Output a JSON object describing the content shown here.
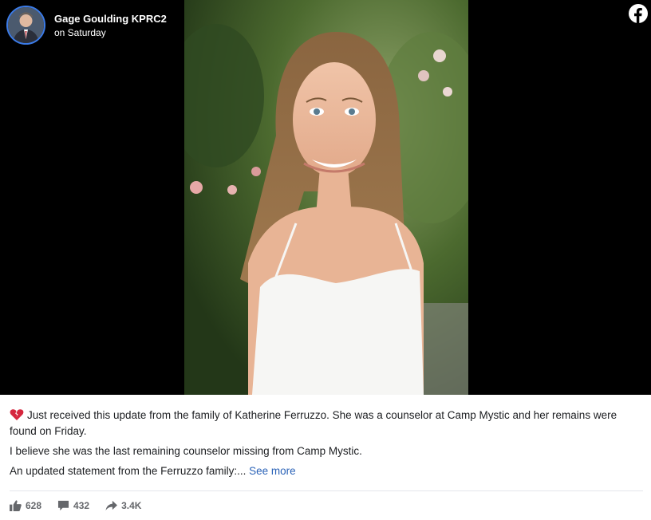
{
  "post": {
    "author": "Gage Goulding KPRC2",
    "time": "on Saturday",
    "avatar_icon": "person-avatar",
    "platform_icon": "facebook-icon",
    "accent_color": "#3b7be8",
    "link_color": "#2a62b7"
  },
  "caption": {
    "emoji_icon": "broken-heart-icon",
    "line1": "Just received this update from the family of Katherine Ferruzzo. She was a counselor at Camp Mystic and her remains were found on Friday.",
    "line2": "I believe she was the last remaining counselor missing from Camp Mystic.",
    "line3": "An updated statement from the Ferruzzo family:...",
    "see_more": "See more"
  },
  "stats": {
    "likes": "628",
    "comments": "432",
    "shares": "3.4K"
  }
}
